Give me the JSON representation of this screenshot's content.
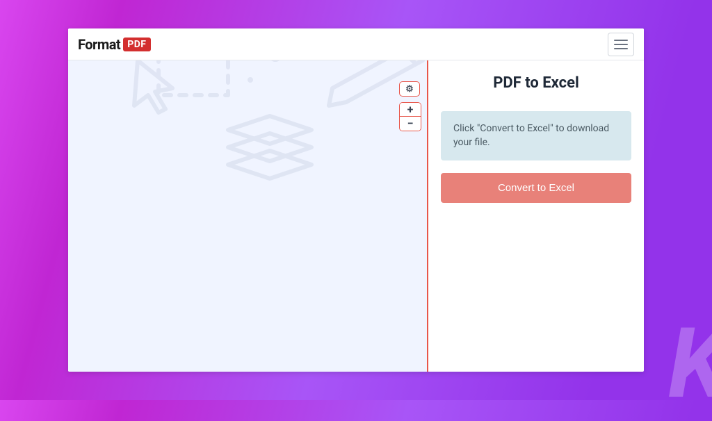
{
  "brand": {
    "name_primary": "Format",
    "name_badge": "PDF"
  },
  "page": {
    "title": "PDF to Excel",
    "info_message": "Click \"Convert to Excel\" to download your file.",
    "convert_label": "Convert to Excel"
  },
  "tools": {
    "settings_label": "⚙",
    "zoom_in_label": "+",
    "zoom_out_label": "−"
  },
  "watermark": "K",
  "colors": {
    "accent_red": "#e8564a",
    "button_red": "#e88179",
    "info_bg": "#d7e8ee",
    "preview_bg": "#f0f4ff"
  }
}
